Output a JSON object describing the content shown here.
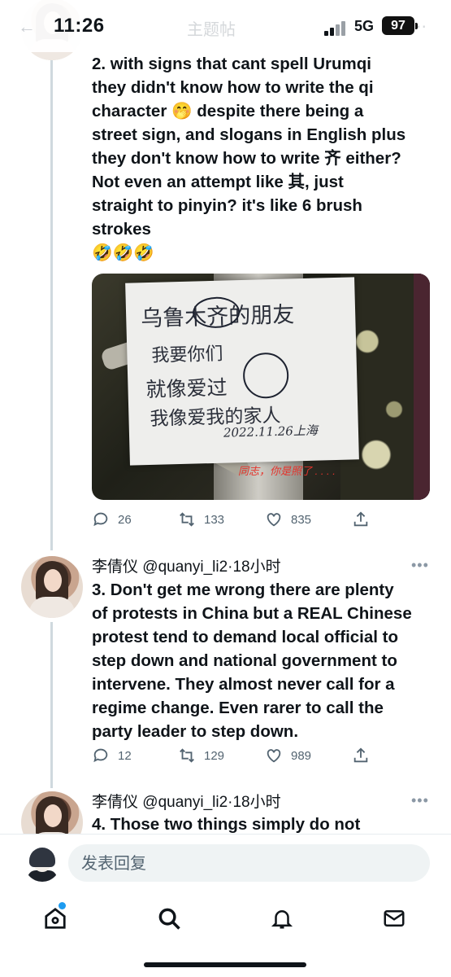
{
  "status_bar": {
    "time": "11:26",
    "network": "5G",
    "battery": "97",
    "faded_title": "主题帖"
  },
  "tweets": [
    {
      "text_lines": [
        "2. with signs that cant spell Urumqi",
        "they didn't know how to write the qi",
        "character 🤭 despite there being a",
        "street sign, and slogans in English plus",
        "they don't know how to write 齐 either?",
        "Not even an attempt like 其, just",
        "straight to pinyin? it's like 6 brush",
        "strokes",
        "🤣🤣🤣"
      ],
      "photo": {
        "handwriting": [
          "乌鲁木齐的朋友",
          "我要你们",
          "就像爱过",
          "我像爱我的家人",
          "2022.11.26上海"
        ],
        "caption": "同志，你是照了 . . . ."
      },
      "stats": {
        "replies": "26",
        "retweets": "133",
        "likes": "835"
      }
    },
    {
      "name": "李倩仪",
      "handle": "@quanyi_li2",
      "time": "·18小时",
      "text_lines": [
        "3. Don't get me wrong there are plenty",
        "of protests in China but a REAL Chinese",
        "protest tend to demand local official to",
        "step down and national government to",
        "intervene. They almost never call for a",
        "regime change. Even rarer to call the",
        "party leader to step down."
      ],
      "stats": {
        "replies": "12",
        "retweets": "129",
        "likes": "989"
      }
    },
    {
      "name": "李倩仪",
      "handle": "@quanyi_li2",
      "time": "·18小时",
      "text_lines": [
        "4. Those two things simply do not"
      ]
    }
  ],
  "reply_bar": {
    "placeholder": "发表回复"
  },
  "colors": {
    "accent": "#1d9bf0",
    "text": "#0f1419",
    "muted": "#536471"
  }
}
